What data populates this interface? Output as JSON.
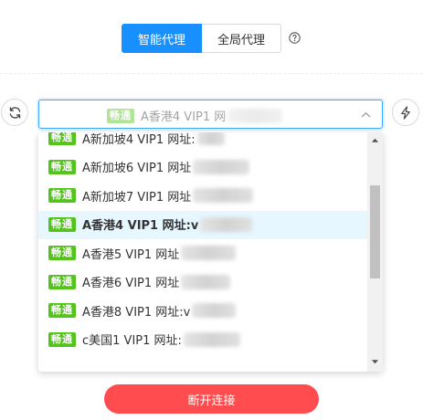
{
  "mode": {
    "smart_label": "智能代理",
    "global_label": "全局代理",
    "help_icon": "question-circle-icon"
  },
  "select": {
    "tag": "畅通",
    "value": "A香港4 VIP1 网",
    "arrow_icon": "chevron-up-icon"
  },
  "refresh_icon": "refresh-icon",
  "flash_icon": "lightning-icon",
  "options": [
    {
      "tag": "畅通",
      "label": "A新加坡4 VIP1 网址:",
      "selected": false
    },
    {
      "tag": "畅通",
      "label": "A新加坡6 VIP1 网址",
      "selected": false
    },
    {
      "tag": "畅通",
      "label": "A新加坡7 VIP1 网址",
      "selected": false
    },
    {
      "tag": "畅通",
      "label": "A香港4 VIP1 网址:v",
      "selected": true
    },
    {
      "tag": "畅通",
      "label": "A香港5 VIP1 网址",
      "selected": false
    },
    {
      "tag": "畅通",
      "label": "A香港6 VIP1 网址",
      "selected": false
    },
    {
      "tag": "畅通",
      "label": "A香港8 VIP1 网址:v",
      "selected": false
    },
    {
      "tag": "畅通",
      "label": "c美国1 VIP1 网址:",
      "selected": false
    }
  ],
  "disconnect_label": "断开连接",
  "colors": {
    "primary": "#1890ff",
    "tag_green": "#52c41a",
    "danger": "#ff4d4f",
    "selected_bg": "#e6f7ff"
  }
}
